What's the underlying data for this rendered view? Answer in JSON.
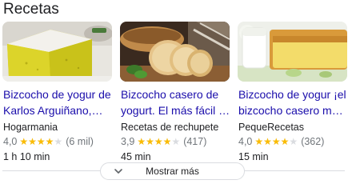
{
  "section": {
    "title": "Recetas"
  },
  "cards": [
    {
      "title": "Bizcocho de yogur de Karlos Arguiñano, ¡fácil y...",
      "source": "Hogarmania",
      "rating": "4,0",
      "rating_fraction": 0.8,
      "reviews": "(6 mil)",
      "time": "1 h 10 min",
      "image_icon": "sponge-cake-photo"
    },
    {
      "title": "Bizcocho casero de yogurt. El más fácil de los...",
      "source": "Recetas de rechupete",
      "rating": "3,9",
      "rating_fraction": 0.78,
      "reviews": "(417)",
      "time": "45 min",
      "image_icon": "sliced-loaf-photo"
    },
    {
      "title": "Bizcocho de yogur ¡el bizcocho casero más fácil de...",
      "source": "PequeRecetas",
      "rating": "4,0",
      "rating_fraction": 0.8,
      "reviews": "(362)",
      "time": "15 min",
      "image_icon": "loaf-with-yogurt-photo"
    }
  ],
  "more_button": {
    "label": "Mostrar más",
    "icon": "chevron-down-icon"
  },
  "colors": {
    "link": "#1a0dab",
    "star": "#fbbc04",
    "star_empty": "#dadce0",
    "text": "#202124",
    "muted": "#70757a",
    "border": "#dadce0"
  }
}
